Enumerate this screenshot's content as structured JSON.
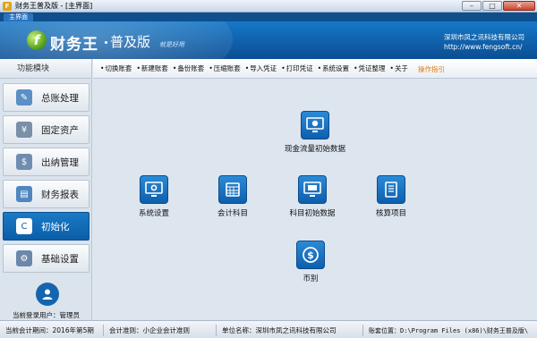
{
  "window": {
    "title": "财务王普及版 - [主界面]",
    "app_icon": "F",
    "controls": {
      "minimize": "–",
      "maximize": "□",
      "close": "✕"
    }
  },
  "tabs": [
    {
      "label": "主界面"
    }
  ],
  "banner": {
    "logo_letter": "f",
    "product_name": "财务王",
    "edition": "普及版",
    "slogan": "就是好用",
    "company_name": "深圳市凤之讯科技有限公司",
    "company_url": "http://www.fengsoft.cn/"
  },
  "sidebar": {
    "header": "功能模块",
    "items": [
      {
        "label": "总账处理",
        "icon": "ledger-icon",
        "active": false
      },
      {
        "label": "固定资产",
        "icon": "asset-icon",
        "active": false
      },
      {
        "label": "出纳管理",
        "icon": "cashier-icon",
        "active": false
      },
      {
        "label": "财务报表",
        "icon": "report-icon",
        "active": false
      },
      {
        "label": "初始化",
        "icon": "init-icon",
        "active": true
      },
      {
        "label": "基础设置",
        "icon": "gear-icon",
        "active": false
      }
    ],
    "current_user": "当前登录用户：管理员"
  },
  "toolbar": {
    "items": [
      "切换账套",
      "新建账套",
      "备份账套",
      "压缩账套",
      "导入凭证",
      "打印凭证",
      "系统设置",
      "凭证整理",
      "关于"
    ],
    "guide": "操作指引"
  },
  "flow": {
    "cash_flow": "现金流量初始数据",
    "system_settings": "系统设置",
    "accounts": "会计科目",
    "initial_data": "科目初始数据",
    "accounting_items": "核算项目",
    "currency": "币别"
  },
  "status": {
    "period": "当前会计期间：2016年第5期",
    "standard": "会计准则：小企业会计准则",
    "company": "单位名称：深圳市凤之讯科技有限公司",
    "location": "账套位置：D:\\Program Files (x86)\\财务王普及版\\"
  }
}
